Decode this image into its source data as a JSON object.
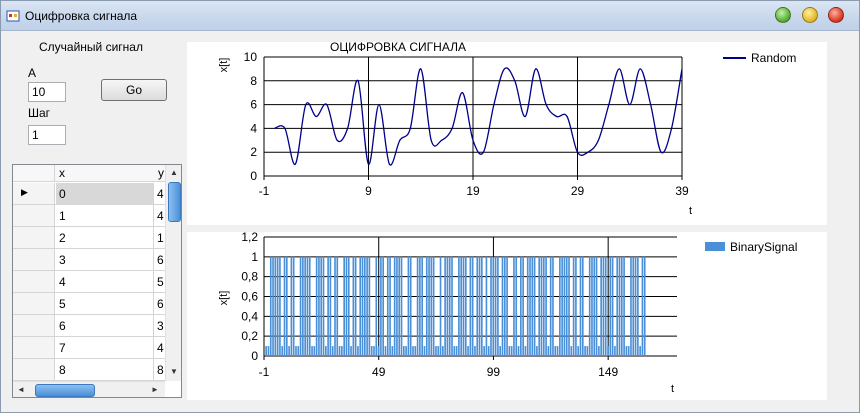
{
  "window": {
    "title": "Оцифровка сигнала"
  },
  "controls": {
    "random_label": "Случайный сигнал",
    "a_label": "A",
    "a_value": "10",
    "go_label": "Go",
    "step_label": "Шаг",
    "step_value": "1"
  },
  "table": {
    "columns": [
      "x",
      "y"
    ],
    "rows": [
      {
        "x": "0",
        "y": "4"
      },
      {
        "x": "1",
        "y": "4"
      },
      {
        "x": "2",
        "y": "1"
      },
      {
        "x": "3",
        "y": "6"
      },
      {
        "x": "4",
        "y": "5"
      },
      {
        "x": "5",
        "y": "6"
      },
      {
        "x": "6",
        "y": "3"
      },
      {
        "x": "7",
        "y": "4"
      },
      {
        "x": "8",
        "y": "8"
      }
    ]
  },
  "chart_data": [
    {
      "type": "line",
      "title": "ОЦИФРОВКА СИГНАЛА",
      "xlabel": "t",
      "ylabel": "x[t]",
      "xlim": [
        -1,
        39
      ],
      "ylim": [
        0,
        10
      ],
      "xticks": [
        "-1",
        "9",
        "19",
        "29",
        "39"
      ],
      "yticks": [
        "0",
        "2",
        "4",
        "6",
        "8",
        "10"
      ],
      "grid": true,
      "legend": "top-right",
      "series": [
        {
          "name": "Random",
          "color": "#00008b",
          "x": [
            0,
            1,
            2,
            3,
            4,
            5,
            6,
            7,
            8,
            9,
            10,
            11,
            12,
            13,
            14,
            15,
            16,
            17,
            18,
            19,
            20,
            21,
            22,
            23,
            24,
            25,
            26,
            27,
            28,
            29,
            30,
            31,
            32,
            33,
            34,
            35,
            36,
            37,
            38,
            39
          ],
          "y": [
            4,
            4,
            1,
            6,
            5,
            6,
            3,
            4,
            8,
            1,
            6,
            1,
            3,
            4,
            9,
            3,
            3,
            4,
            7,
            3,
            2,
            6,
            9,
            8,
            5,
            9,
            6,
            5,
            5,
            2,
            2,
            3,
            6,
            9,
            6,
            9,
            6,
            2,
            4,
            9
          ]
        }
      ]
    },
    {
      "type": "bar",
      "xlabel": "t",
      "ylabel": "x[t]",
      "xlim": [
        -1,
        179
      ],
      "ylim": [
        0,
        1.2
      ],
      "xticks": [
        "-1",
        "49",
        "99",
        "149"
      ],
      "yticks": [
        "0",
        "0,2",
        "0,4",
        "0,6",
        "0,8",
        "1",
        "1,2"
      ],
      "grid": true,
      "legend": "top-right",
      "series": [
        {
          "name": "BinarySignal",
          "color": "#4a90d9",
          "x_start": 0,
          "values": [
            0.1,
            0.1,
            1,
            1,
            1,
            1,
            1,
            0.1,
            1,
            1,
            0.1,
            1,
            1,
            0.1,
            0.1,
            1,
            1,
            1,
            1,
            1,
            0.1,
            0.1,
            1,
            1,
            1,
            1,
            0.1,
            1,
            1,
            0.1,
            1,
            1,
            0.1,
            0.1,
            1,
            1,
            1,
            0.1,
            1,
            1,
            0.1,
            1,
            1,
            1,
            1,
            1,
            0.1,
            0.1,
            1,
            0.1,
            1,
            1,
            0.1,
            1,
            1,
            0.1,
            1,
            1,
            1,
            1,
            0.1,
            0.1,
            1,
            1,
            0.1,
            0.1,
            1,
            1,
            1,
            0.1,
            1,
            1,
            1,
            1,
            0.1,
            0.1,
            1,
            0.1,
            1,
            1,
            1,
            1,
            0.1,
            0.1,
            1,
            1,
            1,
            1,
            0.1,
            1,
            1,
            0.1,
            1,
            1,
            1,
            0.1,
            1,
            0.1,
            1,
            1,
            1,
            1,
            0.1,
            1,
            1,
            1,
            0.1,
            0.1,
            1,
            1,
            0.1,
            1,
            1,
            0.1,
            1,
            1,
            1,
            1,
            0.1,
            1,
            1,
            1,
            1,
            0.1,
            1,
            1,
            0.1,
            0.1,
            1,
            1,
            1,
            1,
            1,
            0.1,
            1,
            1,
            0.1,
            1,
            1,
            0.1,
            0.1,
            1,
            1,
            1,
            1,
            0.1,
            1,
            1,
            1,
            0.1,
            1,
            1,
            0.1,
            1,
            1,
            1,
            1,
            0.1,
            0.1,
            1,
            1,
            1,
            1,
            0.1,
            1,
            1
          ]
        }
      ]
    }
  ]
}
